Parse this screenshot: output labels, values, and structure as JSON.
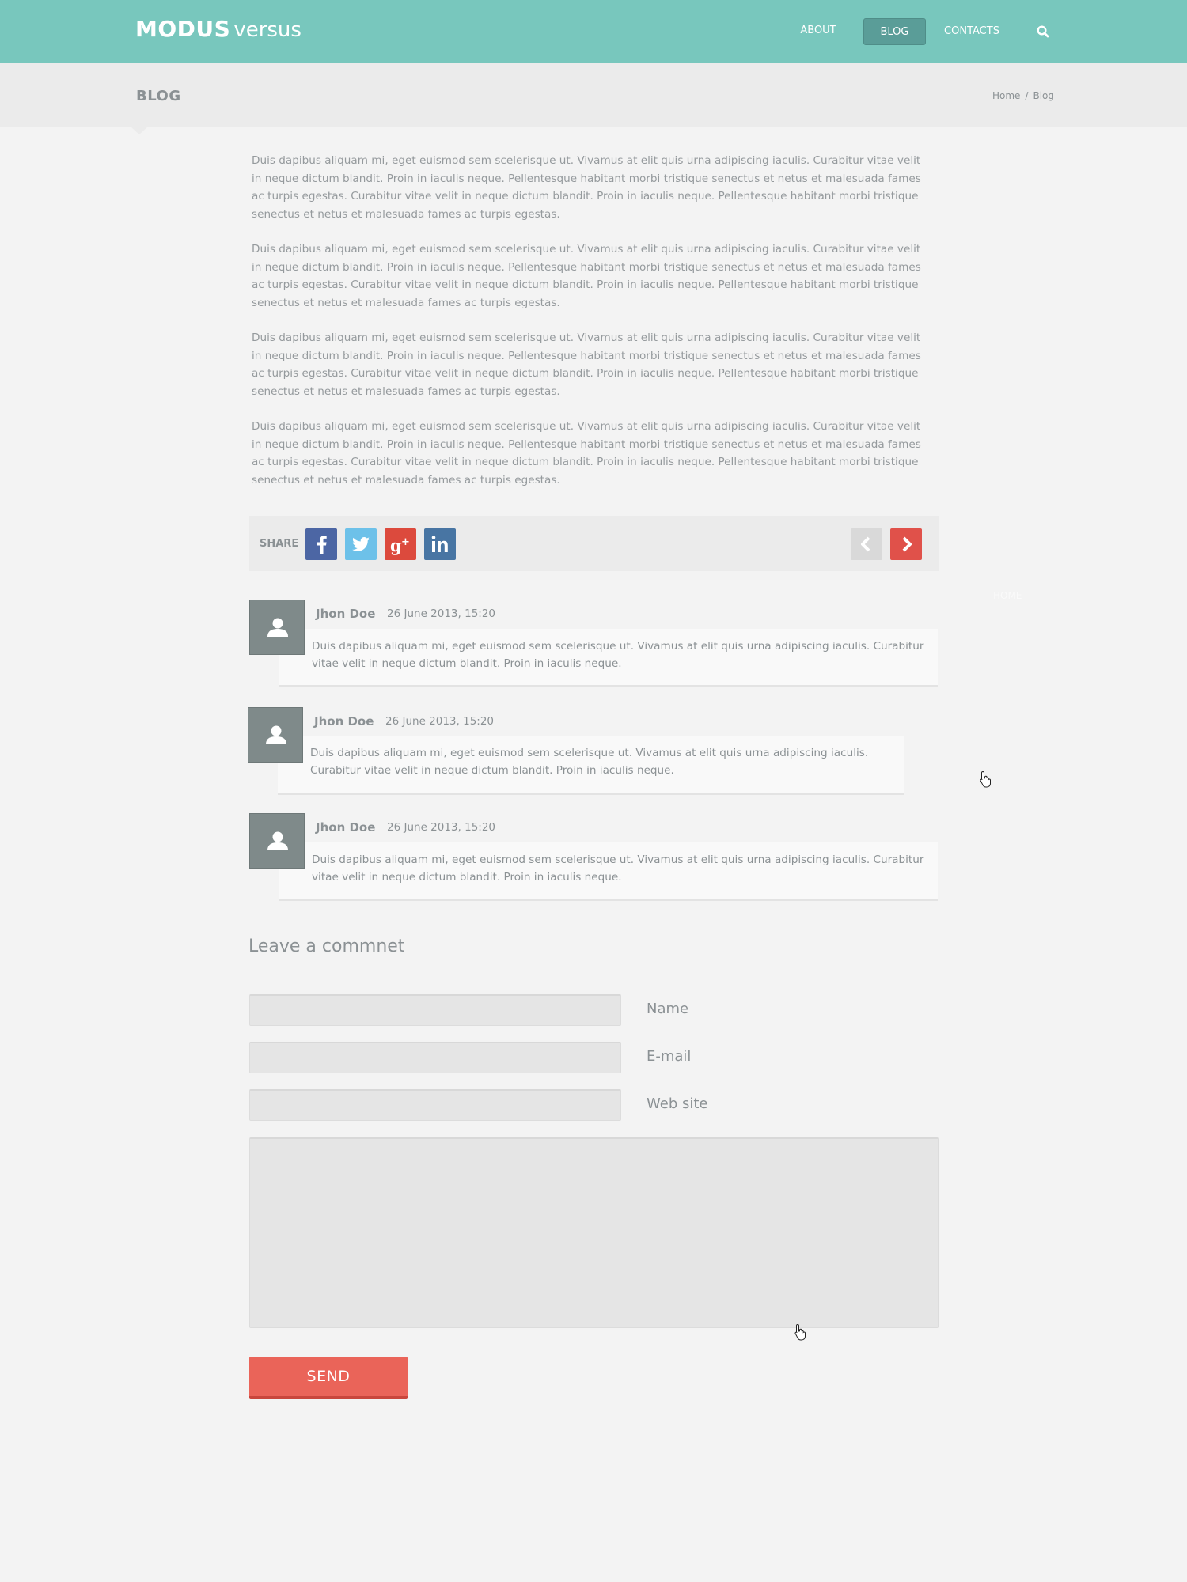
{
  "header": {
    "logo_strong": "MODUS",
    "logo_light": "versus",
    "nav": {
      "about": "ABOUT",
      "blog": "BLOG",
      "contacts": "CONTACTS"
    },
    "search_icon": "search-icon",
    "accent_color": "#78c7bd"
  },
  "titlebar": {
    "title": "BLOG",
    "breadcrumb": {
      "home": "Home",
      "separator": "/",
      "current": "Blog"
    }
  },
  "article": {
    "paragraphs": [
      "Duis dapibus aliquam mi, eget euismod sem scelerisque ut. Vivamus at elit quis urna adipiscing iaculis. Curabitur vitae velit in neque dictum blandit. Proin in iaculis neque. Pellentesque habitant morbi tristique senectus et netus et malesuada fames ac turpis egestas. Curabitur vitae velit in neque dictum blandit. Proin in iaculis neque. Pellentesque habitant morbi tristique senectus et netus et malesuada fames ac turpis egestas.",
      "Duis dapibus aliquam mi, eget euismod sem scelerisque ut. Vivamus at elit quis urna adipiscing iaculis. Curabitur vitae velit in neque dictum blandit. Proin in iaculis neque. Pellentesque habitant morbi tristique senectus et netus et malesuada fames ac turpis egestas. Curabitur vitae velit in neque dictum blandit. Proin in iaculis neque. Pellentesque habitant morbi tristique senectus et netus et malesuada fames ac turpis egestas.",
      "Duis dapibus aliquam mi, eget euismod sem scelerisque ut. Vivamus at elit quis urna adipiscing iaculis. Curabitur vitae velit in neque dictum blandit. Proin in iaculis neque. Pellentesque habitant morbi tristique senectus et netus et malesuada fames ac turpis egestas. Curabitur vitae velit in neque dictum blandit. Proin in iaculis neque. Pellentesque habitant morbi tristique senectus et netus et malesuada fames ac turpis egestas.",
      "Duis dapibus aliquam mi, eget euismod sem scelerisque ut. Vivamus at elit quis urna adipiscing iaculis. Curabitur vitae velit in neque dictum blandit. Proin in iaculis neque. Pellentesque habitant morbi tristique senectus et netus et malesuada fames ac turpis egestas. Curabitur vitae velit in neque dictum blandit. Proin in iaculis neque. Pellentesque habitant morbi tristique senectus et netus et malesuada fames ac turpis egestas."
    ]
  },
  "share": {
    "label": "SHARE",
    "networks": [
      "facebook-icon",
      "twitter-icon",
      "google-plus-icon",
      "linkedin-icon"
    ],
    "prev_icon": "chevron-left-icon",
    "next_icon": "chevron-right-icon"
  },
  "comments": [
    {
      "name": "Jhon Doe",
      "date": "26 June 2013, 15:20",
      "text": "Duis dapibus aliquam mi, eget euismod sem scelerisque ut. Vivamus at elit quis urna adipiscing iaculis. Curabitur vitae velit in neque dictum blandit. Proin in iaculis neque."
    },
    {
      "name": "Jhon Doe",
      "date": "26 June 2013, 15:20",
      "text": "Duis dapibus aliquam mi, eget euismod sem scelerisque ut. Vivamus at elit quis urna adipiscing iaculis. Curabitur vitae velit in neque dictum blandit. Proin in iaculis neque."
    },
    {
      "name": "Jhon Doe",
      "date": "26 June 2013, 15:20",
      "text": "Duis dapibus aliquam mi, eget euismod sem scelerisque ut. Vivamus at elit quis urna adipiscing iaculis. Curabitur vitae velit in neque dictum blandit. Proin in iaculis neque."
    }
  ],
  "form": {
    "title": "Leave a commnet",
    "name_label": "Name",
    "name_value": "",
    "email_label": "E-mail",
    "email_value": "",
    "website_label": "Web site",
    "website_value": "",
    "message_value": "",
    "send_label": "SEND",
    "send_color": "#ea6459"
  },
  "ghost_text": "HOME"
}
